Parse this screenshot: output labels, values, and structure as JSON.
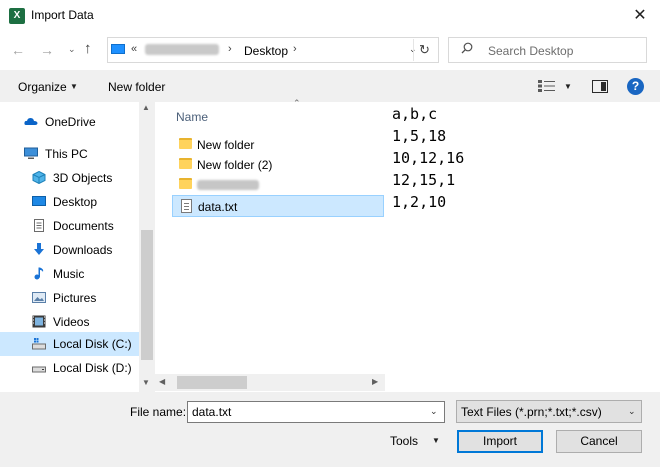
{
  "window": {
    "title": "Import Data",
    "app_icon": "X",
    "close": "✕"
  },
  "address_bar": {
    "prefix": "«",
    "current_folder": "Desktop",
    "separator": "›",
    "refresh": "↻"
  },
  "search": {
    "placeholder": "Search Desktop"
  },
  "toolbar": {
    "organize_label": "Organize",
    "new_folder_label": "New folder",
    "help": "?"
  },
  "nav_pane": {
    "items": [
      {
        "label": "OneDrive",
        "icon": "cloud-icon"
      },
      {
        "label": "This PC",
        "icon": "pc-icon"
      },
      {
        "label": "3D Objects",
        "icon": "cube-icon"
      },
      {
        "label": "Desktop",
        "icon": "desktop-icon"
      },
      {
        "label": "Documents",
        "icon": "documents-icon"
      },
      {
        "label": "Downloads",
        "icon": "download-icon"
      },
      {
        "label": "Music",
        "icon": "music-icon"
      },
      {
        "label": "Pictures",
        "icon": "pictures-icon"
      },
      {
        "label": "Videos",
        "icon": "videos-icon"
      },
      {
        "label": "Local Disk (C:)",
        "icon": "drive-icon",
        "selected": true
      },
      {
        "label": "Local Disk (D:)",
        "icon": "drive-icon"
      }
    ]
  },
  "file_list": {
    "column_name": "Name",
    "files": [
      {
        "name": "New folder",
        "type": "folder"
      },
      {
        "name": "New folder (2)",
        "type": "folder"
      },
      {
        "name": "",
        "type": "folder",
        "blurred": true
      },
      {
        "name": "data.txt",
        "type": "text",
        "selected": true
      }
    ]
  },
  "preview": {
    "lines": [
      "a,b,c",
      "1,5,18",
      "10,12,16",
      "12,15,1",
      "1,2,10"
    ]
  },
  "bottom": {
    "file_name_label": "File name:",
    "file_name_value": "data.txt",
    "file_type": "Text Files (*.prn;*.txt;*.csv)",
    "tools_label": "Tools",
    "import_label": "Import",
    "cancel_label": "Cancel"
  },
  "colors": {
    "accent": "#0078d7",
    "selection": "#cce8ff",
    "excel_green": "#1d6f42"
  }
}
